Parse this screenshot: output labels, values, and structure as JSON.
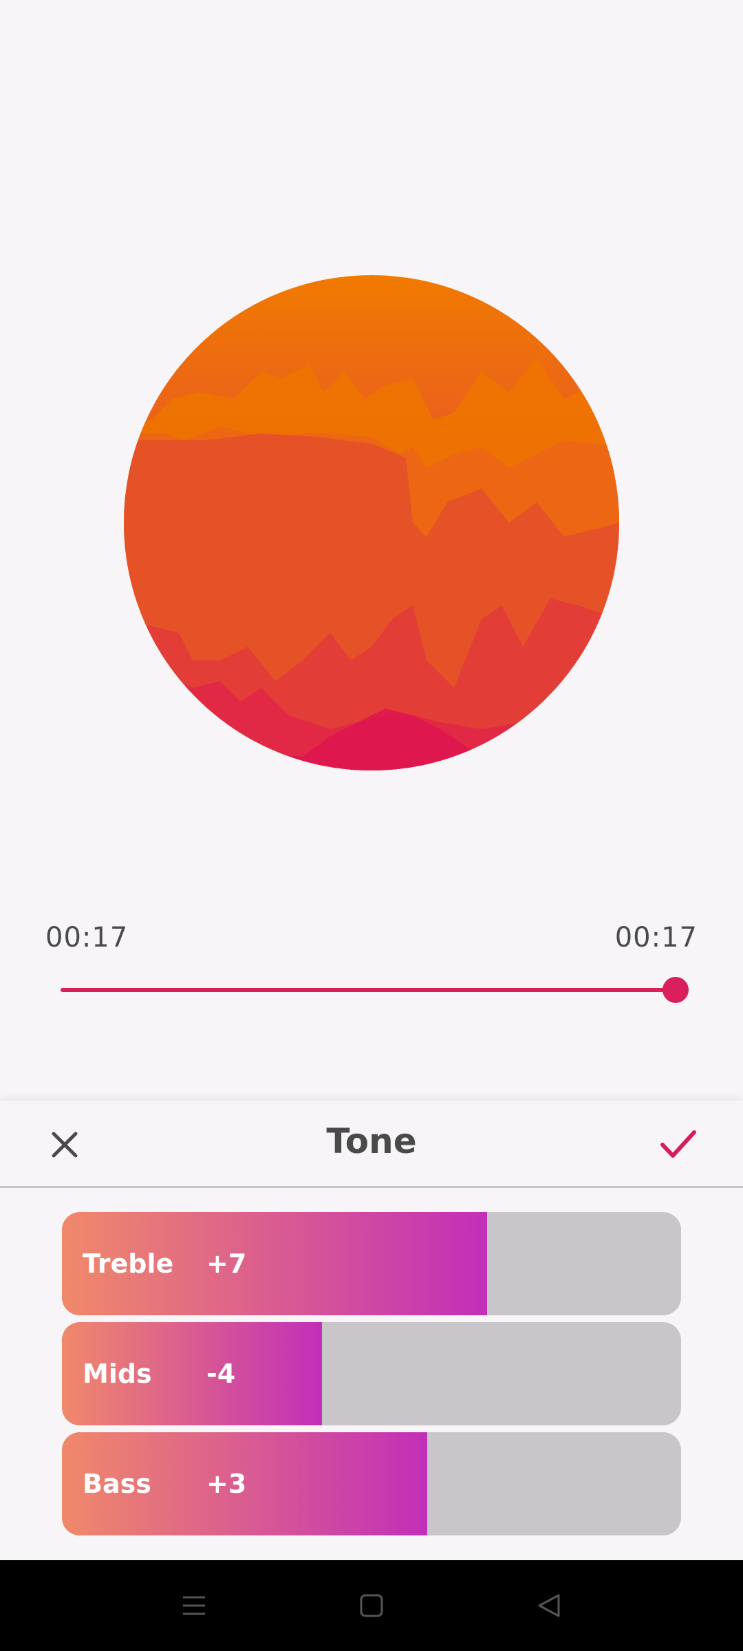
{
  "player": {
    "current_time": "00:17",
    "total_time": "00:17",
    "progress": 1.0,
    "accent_color": "#d91f5c"
  },
  "sheet": {
    "title": "Tone",
    "close_icon": "close-icon",
    "confirm_icon": "check-icon",
    "confirm_color": "#d41e5e"
  },
  "tone": {
    "items": [
      {
        "label": "Treble",
        "value": "+7",
        "level": 0.687
      },
      {
        "label": "Mids",
        "value": "-4",
        "level": 0.42
      },
      {
        "label": "Bass",
        "value": "+3",
        "level": 0.59
      }
    ],
    "gradient_start": "#f0896a",
    "gradient_end": "#c22fb8"
  },
  "navbar": {
    "icons": [
      "menu-icon",
      "home-square-icon",
      "back-triangle-icon"
    ]
  }
}
